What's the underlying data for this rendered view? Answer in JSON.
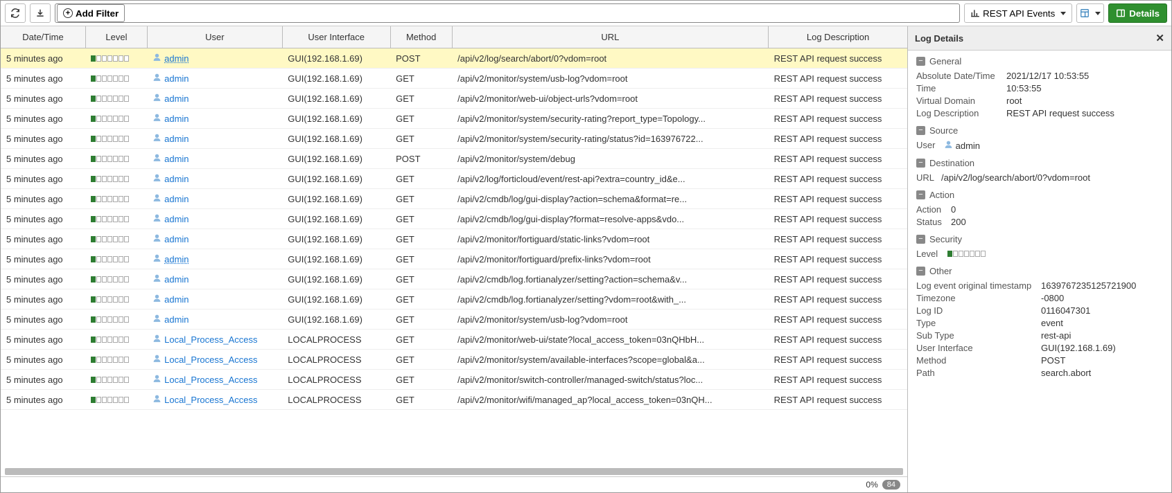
{
  "toolbar": {
    "add_filter": "Add Filter",
    "dropdown_label": "REST API Events",
    "details_btn": "Details"
  },
  "columns": {
    "dt": "Date/Time",
    "level": "Level",
    "user": "User",
    "ui": "User Interface",
    "method": "Method",
    "url": "URL",
    "desc": "Log Description"
  },
  "rows": [
    {
      "dt": "5 minutes ago",
      "user": "admin",
      "user_link": true,
      "ui": "GUI(192.168.1.69)",
      "method": "POST",
      "url": "/api/v2/log/search/abort/0?vdom=root",
      "desc": "REST API request success",
      "selected": true
    },
    {
      "dt": "5 minutes ago",
      "user": "admin",
      "user_link": false,
      "ui": "GUI(192.168.1.69)",
      "method": "GET",
      "url": "/api/v2/monitor/system/usb-log?vdom=root",
      "desc": "REST API request success"
    },
    {
      "dt": "5 minutes ago",
      "user": "admin",
      "user_link": false,
      "ui": "GUI(192.168.1.69)",
      "method": "GET",
      "url": "/api/v2/monitor/web-ui/object-urls?vdom=root",
      "desc": "REST API request success"
    },
    {
      "dt": "5 minutes ago",
      "user": "admin",
      "user_link": false,
      "ui": "GUI(192.168.1.69)",
      "method": "GET",
      "url": "/api/v2/monitor/system/security-rating?report_type=Topology...",
      "desc": "REST API request success"
    },
    {
      "dt": "5 minutes ago",
      "user": "admin",
      "user_link": false,
      "ui": "GUI(192.168.1.69)",
      "method": "GET",
      "url": "/api/v2/monitor/system/security-rating/status?id=163976722...",
      "desc": "REST API request success"
    },
    {
      "dt": "5 minutes ago",
      "user": "admin",
      "user_link": false,
      "ui": "GUI(192.168.1.69)",
      "method": "POST",
      "url": "/api/v2/monitor/system/debug",
      "desc": "REST API request success"
    },
    {
      "dt": "5 minutes ago",
      "user": "admin",
      "user_link": false,
      "ui": "GUI(192.168.1.69)",
      "method": "GET",
      "url": "/api/v2/log/forticloud/event/rest-api?extra=country_id&amp;e...",
      "desc": "REST API request success"
    },
    {
      "dt": "5 minutes ago",
      "user": "admin",
      "user_link": false,
      "ui": "GUI(192.168.1.69)",
      "method": "GET",
      "url": "/api/v2/cmdb/log/gui-display?action=schema&amp;format=re...",
      "desc": "REST API request success"
    },
    {
      "dt": "5 minutes ago",
      "user": "admin",
      "user_link": false,
      "ui": "GUI(192.168.1.69)",
      "method": "GET",
      "url": "/api/v2/cmdb/log/gui-display?format=resolve-apps&amp;vdo...",
      "desc": "REST API request success"
    },
    {
      "dt": "5 minutes ago",
      "user": "admin",
      "user_link": false,
      "ui": "GUI(192.168.1.69)",
      "method": "GET",
      "url": "/api/v2/monitor/fortiguard/static-links?vdom=root",
      "desc": "REST API request success"
    },
    {
      "dt": "5 minutes ago",
      "user": "admin",
      "user_link": true,
      "ui": "GUI(192.168.1.69)",
      "method": "GET",
      "url": "/api/v2/monitor/fortiguard/prefix-links?vdom=root",
      "desc": "REST API request success"
    },
    {
      "dt": "5 minutes ago",
      "user": "admin",
      "user_link": false,
      "ui": "GUI(192.168.1.69)",
      "method": "GET",
      "url": "/api/v2/cmdb/log.fortianalyzer/setting?action=schema&amp;v...",
      "desc": "REST API request success"
    },
    {
      "dt": "5 minutes ago",
      "user": "admin",
      "user_link": false,
      "ui": "GUI(192.168.1.69)",
      "method": "GET",
      "url": "/api/v2/cmdb/log.fortianalyzer/setting?vdom=root&amp;with_...",
      "desc": "REST API request success"
    },
    {
      "dt": "5 minutes ago",
      "user": "admin",
      "user_link": false,
      "ui": "GUI(192.168.1.69)",
      "method": "GET",
      "url": "/api/v2/monitor/system/usb-log?vdom=root",
      "desc": "REST API request success"
    },
    {
      "dt": "5 minutes ago",
      "user": "Local_Process_Access",
      "user_link": false,
      "ui": "LOCALPROCESS",
      "method": "GET",
      "url": "/api/v2/monitor/web-ui/state?local_access_token=03nQHbH...",
      "desc": "REST API request success"
    },
    {
      "dt": "5 minutes ago",
      "user": "Local_Process_Access",
      "user_link": false,
      "ui": "LOCALPROCESS",
      "method": "GET",
      "url": "/api/v2/monitor/system/available-interfaces?scope=global&a...",
      "desc": "REST API request success"
    },
    {
      "dt": "5 minutes ago",
      "user": "Local_Process_Access",
      "user_link": false,
      "ui": "LOCALPROCESS",
      "method": "GET",
      "url": "/api/v2/monitor/switch-controller/managed-switch/status?loc...",
      "desc": "REST API request success"
    },
    {
      "dt": "5 minutes ago",
      "user": "Local_Process_Access",
      "user_link": false,
      "ui": "LOCALPROCESS",
      "method": "GET",
      "url": "/api/v2/monitor/wifi/managed_ap?local_access_token=03nQH...",
      "desc": "REST API request success"
    }
  ],
  "footer": {
    "progress": "0%",
    "count": "84"
  },
  "details": {
    "title": "Log Details",
    "sections": {
      "general": {
        "title": "General",
        "items": [
          {
            "label": "Absolute Date/Time",
            "value": "2021/12/17 10:53:55"
          },
          {
            "label": "Time",
            "value": "10:53:55"
          },
          {
            "label": "Virtual Domain",
            "value": "root"
          },
          {
            "label": "Log Description",
            "value": "REST API request success"
          }
        ]
      },
      "source": {
        "title": "Source",
        "user_label": "User",
        "user_value": "admin"
      },
      "destination": {
        "title": "Destination",
        "url_label": "URL",
        "url_value": "/api/v2/log/search/abort/0?vdom=root"
      },
      "action": {
        "title": "Action",
        "items": [
          {
            "label": "Action",
            "value": "0"
          },
          {
            "label": "Status",
            "value": "200"
          }
        ]
      },
      "security": {
        "title": "Security",
        "level_label": "Level"
      },
      "other": {
        "title": "Other",
        "items": [
          {
            "label": "Log event original timestamp",
            "value": "1639767235125721900",
            "wide": true
          },
          {
            "label": "Timezone",
            "value": "-0800",
            "wide": true
          },
          {
            "label": "Log ID",
            "value": "0116047301",
            "wide": true
          },
          {
            "label": "Type",
            "value": "event",
            "wide": true
          },
          {
            "label": "Sub Type",
            "value": "rest-api",
            "wide": true
          },
          {
            "label": "User Interface",
            "value": "GUI(192.168.1.69)",
            "wide": true
          },
          {
            "label": "Method",
            "value": "POST",
            "wide": true
          },
          {
            "label": "Path",
            "value": "search.abort",
            "wide": true
          }
        ]
      }
    }
  }
}
